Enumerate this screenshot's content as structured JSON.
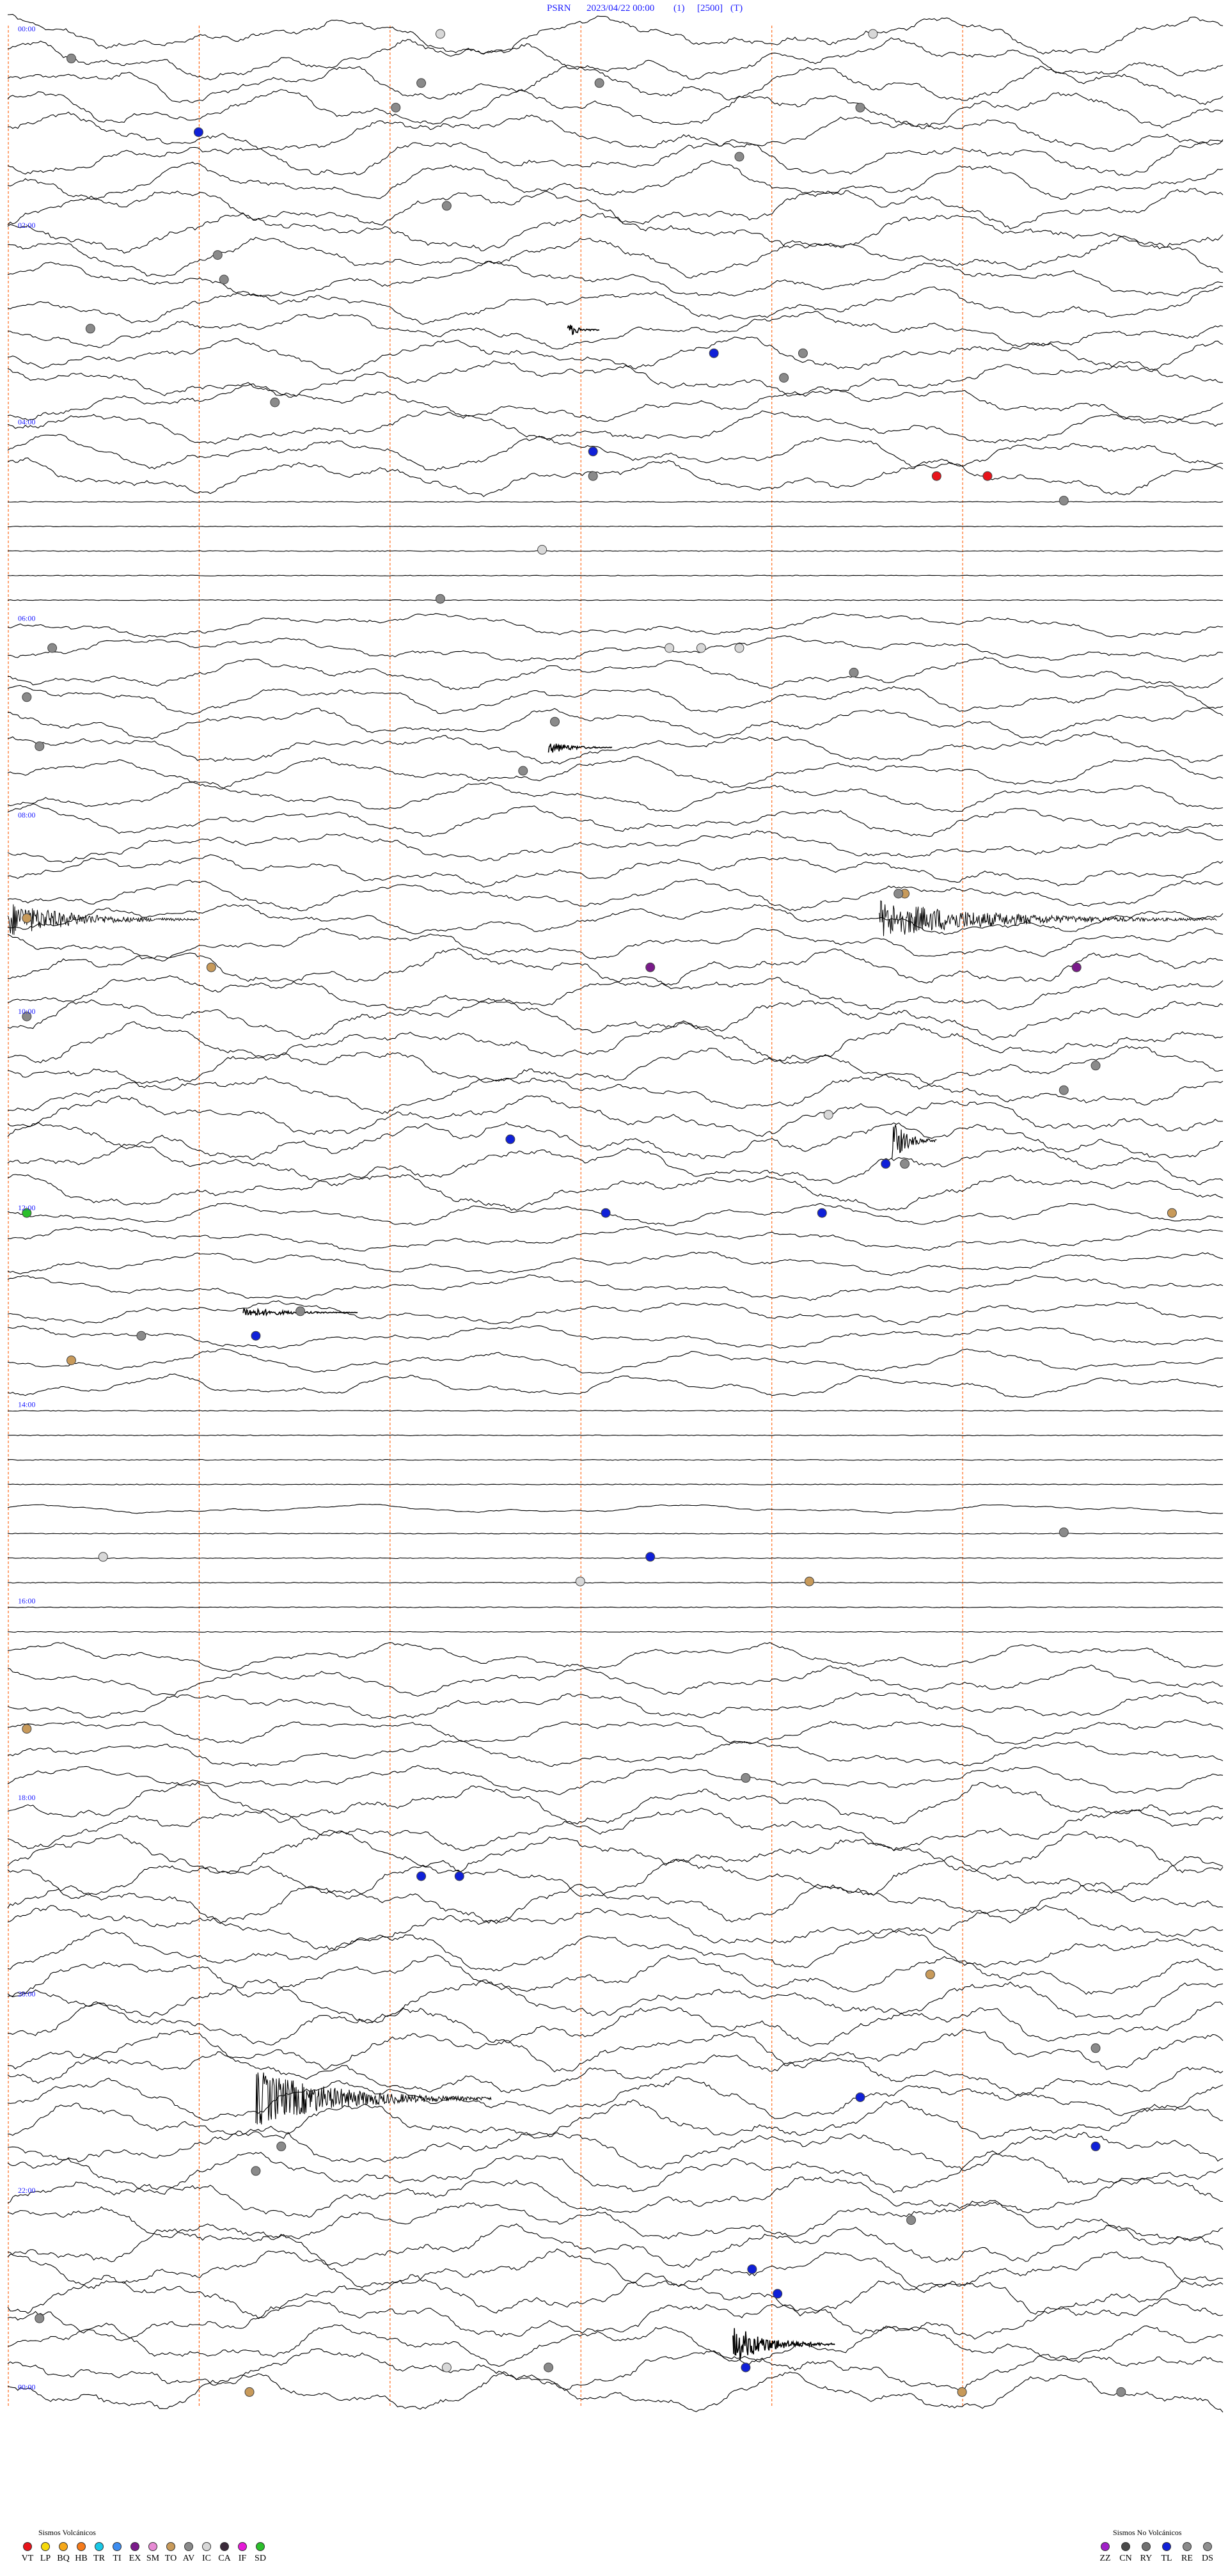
{
  "header": {
    "station": "PSRN",
    "datetime": "2023/04/22 00:00",
    "component": "(1)",
    "scale": "[2500]",
    "mode": "(T)"
  },
  "chart_data": {
    "type": "helicorder",
    "lines_per_hour": 4,
    "minutes_per_line": 15,
    "total_lines": 97,
    "hour_labels": [
      "00:00",
      "02:00",
      "04:00",
      "06:00",
      "08:00",
      "10:00",
      "12:00",
      "14:00",
      "16:00",
      "18:00",
      "20:00",
      "22:00",
      "00:00"
    ],
    "hour_label_lines": [
      0,
      8,
      16,
      24,
      32,
      40,
      48,
      56,
      64,
      72,
      80,
      88,
      96
    ],
    "minute_markers": [
      0,
      3,
      6,
      9,
      12,
      15
    ],
    "colors": {
      "trace": "#000000",
      "header_text": "#1a1aff",
      "minute_markers": "#ff6a1a",
      "VT": "#e8141b",
      "LP": "#f5d90a",
      "BQ": "#f5a81a",
      "HB": "#f57a1a",
      "TR": "#19c8e6",
      "TI": "#3c8cf0",
      "EX": "#7a1a8a",
      "SM": "#e78ad4",
      "TO": "#c89a5a",
      "AV": "#8a8a8a",
      "IC": "#d8d8d8",
      "CA": "#3a2a3a",
      "IF": "#e61ad8",
      "SD": "#2bbf2b",
      "ZZ": "#a020c8",
      "CN": "#4a4a4a",
      "RY": "#707070",
      "TL": "#1020d8",
      "RE": "#8a8a8a",
      "DS": "#909090"
    },
    "events": [
      {
        "line": 1,
        "minute": 1.0,
        "type": "AV"
      },
      {
        "line": 0,
        "minute": 6.8,
        "type": "IC"
      },
      {
        "line": 3,
        "minute": 6.1,
        "type": "AV"
      },
      {
        "line": 4,
        "minute": 3.0,
        "type": "TL"
      },
      {
        "line": 2,
        "minute": 6.5,
        "type": "AV"
      },
      {
        "line": 2,
        "minute": 9.3,
        "type": "AV"
      },
      {
        "line": 0,
        "minute": 13.6,
        "type": "IC"
      },
      {
        "line": 3,
        "minute": 13.4,
        "type": "AV"
      },
      {
        "line": 5,
        "minute": 11.5,
        "type": "AV"
      },
      {
        "line": 7,
        "minute": 6.9,
        "type": "AV"
      },
      {
        "line": 9,
        "minute": 3.3,
        "type": "AV"
      },
      {
        "line": 10,
        "minute": 3.4,
        "type": "AV"
      },
      {
        "line": 12,
        "minute": 1.3,
        "type": "AV"
      },
      {
        "line": 13,
        "minute": 11.1,
        "type": "TL"
      },
      {
        "line": 13,
        "minute": 12.5,
        "type": "AV"
      },
      {
        "line": 14,
        "minute": 12.2,
        "type": "AV"
      },
      {
        "line": 15,
        "minute": 4.2,
        "type": "AV"
      },
      {
        "line": 17,
        "minute": 9.2,
        "type": "TL"
      },
      {
        "line": 18,
        "minute": 9.2,
        "type": "AV"
      },
      {
        "line": 18,
        "minute": 14.6,
        "type": "VT"
      },
      {
        "line": 18,
        "minute": 15.4,
        "type": "VT"
      },
      {
        "line": 19,
        "minute": 16.6,
        "type": "AV"
      },
      {
        "line": 21,
        "minute": 8.4,
        "type": "IC"
      },
      {
        "line": 23,
        "minute": 6.8,
        "type": "AV"
      },
      {
        "line": 25,
        "minute": 0.7,
        "type": "AV"
      },
      {
        "line": 25,
        "minute": 10.4,
        "type": "IC"
      },
      {
        "line": 25,
        "minute": 10.9,
        "type": "IC"
      },
      {
        "line": 25,
        "minute": 11.5,
        "type": "IC"
      },
      {
        "line": 26,
        "minute": 13.3,
        "type": "AV"
      },
      {
        "line": 27,
        "minute": 0.3,
        "type": "AV"
      },
      {
        "line": 28,
        "minute": 8.6,
        "type": "AV"
      },
      {
        "line": 29,
        "minute": 0.5,
        "type": "AV"
      },
      {
        "line": 30,
        "minute": 8.1,
        "type": "AV"
      },
      {
        "line": 35,
        "minute": 14.1,
        "type": "TO"
      },
      {
        "line": 35,
        "minute": 14.0,
        "type": "AV"
      },
      {
        "line": 36,
        "minute": 0.3,
        "type": "TO"
      },
      {
        "line": 38,
        "minute": 3.2,
        "type": "TO"
      },
      {
        "line": 38,
        "minute": 10.1,
        "type": "EX"
      },
      {
        "line": 38,
        "minute": 16.8,
        "type": "EX"
      },
      {
        "line": 40,
        "minute": 0.3,
        "type": "AV"
      },
      {
        "line": 42,
        "minute": 17.1,
        "type": "AV"
      },
      {
        "line": 43,
        "minute": 16.6,
        "type": "AV"
      },
      {
        "line": 44,
        "minute": 12.9,
        "type": "IC"
      },
      {
        "line": 45,
        "minute": 7.9,
        "type": "TL"
      },
      {
        "line": 46,
        "minute": 13.8,
        "type": "TL"
      },
      {
        "line": 46,
        "minute": 14.1,
        "type": "AV"
      },
      {
        "line": 48,
        "minute": 9.4,
        "type": "TL"
      },
      {
        "line": 48,
        "minute": 12.8,
        "type": "TL"
      },
      {
        "line": 48,
        "minute": 0.3,
        "type": "SD"
      },
      {
        "line": 48,
        "minute": 18.3,
        "type": "TO"
      },
      {
        "line": 52,
        "minute": 4.6,
        "type": "AV"
      },
      {
        "line": 53,
        "minute": 2.1,
        "type": "AV"
      },
      {
        "line": 54,
        "minute": 1.0,
        "type": "TO"
      },
      {
        "line": 53,
        "minute": 3.9,
        "type": "TL"
      },
      {
        "line": 61,
        "minute": 16.6,
        "type": "AV"
      },
      {
        "line": 62,
        "minute": 10.1,
        "type": "TL"
      },
      {
        "line": 62,
        "minute": 1.5,
        "type": "IC"
      },
      {
        "line": 63,
        "minute": 9.0,
        "type": "IC"
      },
      {
        "line": 63,
        "minute": 12.6,
        "type": "TO"
      },
      {
        "line": 69,
        "minute": 0.3,
        "type": "TO"
      },
      {
        "line": 71,
        "minute": 11.6,
        "type": "AV"
      },
      {
        "line": 75,
        "minute": 6.5,
        "type": "TL"
      },
      {
        "line": 75,
        "minute": 7.1,
        "type": "TL"
      },
      {
        "line": 79,
        "minute": 14.5,
        "type": "TO"
      },
      {
        "line": 82,
        "minute": 17.1,
        "type": "AV"
      },
      {
        "line": 84,
        "minute": 13.4,
        "type": "TL"
      },
      {
        "line": 86,
        "minute": 4.3,
        "type": "AV"
      },
      {
        "line": 86,
        "minute": 17.1,
        "type": "TL"
      },
      {
        "line": 87,
        "minute": 3.9,
        "type": "AV"
      },
      {
        "line": 89,
        "minute": 14.2,
        "type": "AV"
      },
      {
        "line": 91,
        "minute": 11.7,
        "type": "TL"
      },
      {
        "line": 92,
        "minute": 12.1,
        "type": "TL"
      },
      {
        "line": 93,
        "minute": 0.5,
        "type": "AV"
      },
      {
        "line": 95,
        "minute": 6.9,
        "type": "IC"
      },
      {
        "line": 95,
        "minute": 8.5,
        "type": "AV"
      },
      {
        "line": 95,
        "minute": 11.6,
        "type": "TL"
      },
      {
        "line": 96,
        "minute": 17.5,
        "type": "AV"
      },
      {
        "line": 96,
        "minute": 3.8,
        "type": "TO"
      },
      {
        "line": 96,
        "minute": 15.0,
        "type": "TO"
      }
    ],
    "legend": {
      "volcanic_title": "Sismos Volcánicos",
      "volcanic_codes": [
        "VT",
        "LP",
        "BQ",
        "HB",
        "TR",
        "TI",
        "EX",
        "SM",
        "TO",
        "AV",
        "IC",
        "CA",
        "IF",
        "SD"
      ],
      "non_volcanic_title": "Sismos No Volcánicos",
      "non_volcanic_codes": [
        "ZZ",
        "CN",
        "RY",
        "TL",
        "RE",
        "DS"
      ]
    }
  }
}
